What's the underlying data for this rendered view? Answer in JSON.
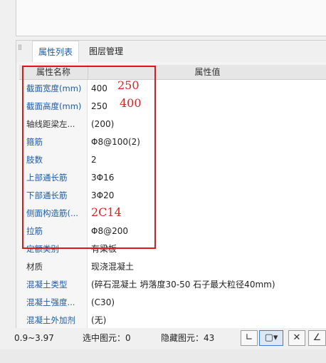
{
  "tabs": {
    "active": "属性列表",
    "inactive": "图层管理"
  },
  "table": {
    "col_name": "属性名称",
    "col_value": "属性值"
  },
  "rows": [
    {
      "name": "截面宽度(mm)",
      "value": "400",
      "blue": true
    },
    {
      "name": "截面高度(mm)",
      "value": "250",
      "blue": true
    },
    {
      "name": "轴线距梁左...",
      "value": "(200)",
      "blue": false
    },
    {
      "name": "箍筋",
      "value": "Φ8@100(2)",
      "blue": true
    },
    {
      "name": "肢数",
      "value": "2",
      "blue": true
    },
    {
      "name": "上部通长筋",
      "value": "3Φ16",
      "blue": true
    },
    {
      "name": "下部通长筋",
      "value": "3Φ20",
      "blue": true
    },
    {
      "name": "侧面构造筋(...",
      "value": "",
      "blue": true
    },
    {
      "name": "拉筋",
      "value": "Φ8@200",
      "blue": true
    },
    {
      "name": "定额类别",
      "value": "有梁板",
      "blue": true
    },
    {
      "name": "材质",
      "value": "现浇混凝土",
      "blue": false
    },
    {
      "name": "混凝土类型",
      "value": "(碎石混凝土 坍落度30-50 石子最大粒径40mm)",
      "blue": true
    },
    {
      "name": "混凝土强度...",
      "value": "(C30)",
      "blue": true
    },
    {
      "name": "混凝土外加剂",
      "value": "(无)",
      "blue": true
    }
  ],
  "annotations": {
    "a1": "250",
    "a2": "400",
    "a3": "2C14"
  },
  "status": {
    "range": "0.9~3.97",
    "selected": "选中图元：0",
    "hidden": "隐藏图元：43"
  },
  "colors": {
    "red_annotation": "#e02020",
    "blue_label": "#1e5aa8"
  }
}
